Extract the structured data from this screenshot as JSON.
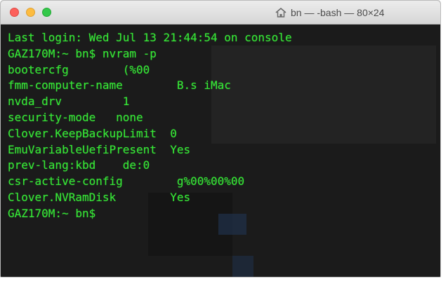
{
  "window": {
    "title": "bn — -bash — 80×24",
    "title_icon": "home-icon",
    "colors": {
      "terminal_background": "#1b1b1b",
      "terminal_text": "#36e436",
      "close_button": "#fc605b",
      "minimize_button": "#fdbc40",
      "zoom_button": "#34c84a"
    }
  },
  "terminal": {
    "lines": [
      "Last login: Wed Jul 13 21:44:54 on console",
      "GAZ170M:~ bn$ nvram -p",
      "bootercfg        (%00",
      "fmm-computer-name        B.s iMac",
      "nvda_drv         1",
      "security-mode   none",
      "Clover.KeepBackupLimit  0",
      "EmuVariableUefiPresent  Yes",
      "prev-lang:kbd    de:0",
      "csr-active-config        g%00%00%00",
      "Clover.NVRamDisk        Yes",
      "GAZ170M:~ bn$"
    ]
  }
}
